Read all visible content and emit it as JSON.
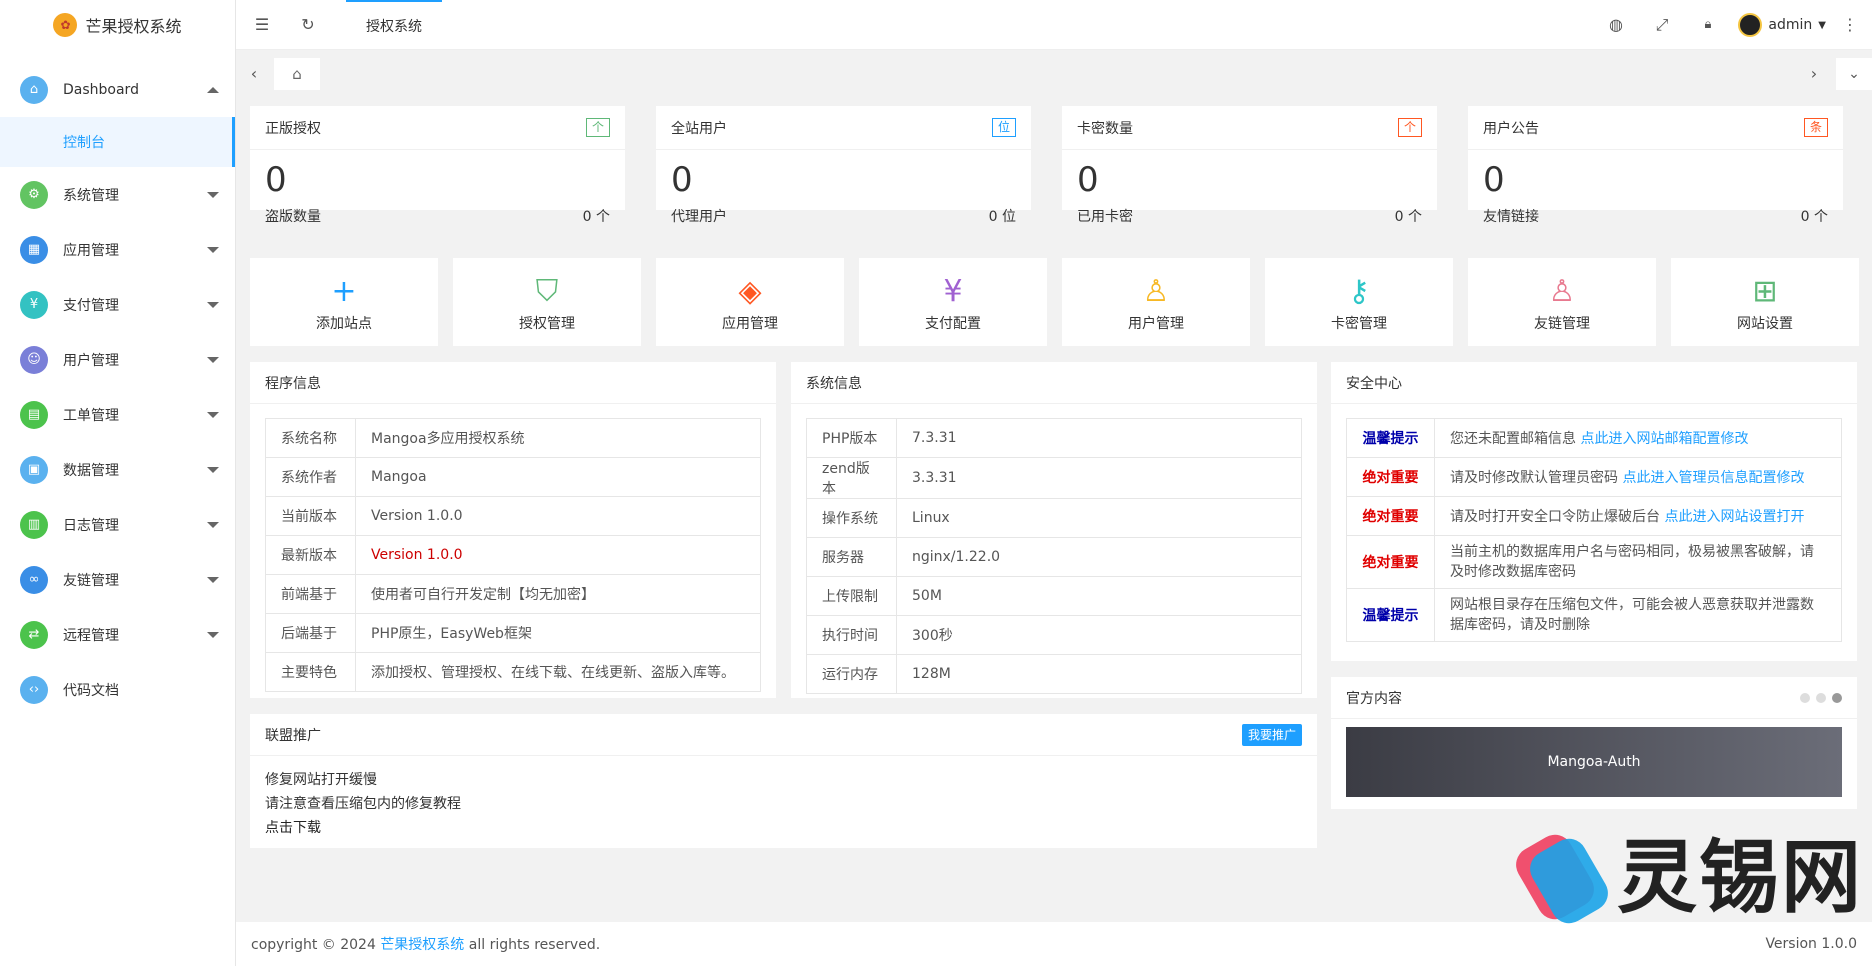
{
  "app": {
    "title": "芒果授权系统",
    "logo_glyph": "✿"
  },
  "sidebar": {
    "items": [
      {
        "label": "Dashboard",
        "icon": "⌂",
        "color": "#5ab1ef",
        "expanded": true
      },
      {
        "label": "系统管理",
        "icon": "⚙",
        "color": "#62c462"
      },
      {
        "label": "应用管理",
        "icon": "▦",
        "color": "#3a8ee6"
      },
      {
        "label": "支付管理",
        "icon": "¥",
        "color": "#33c2c2"
      },
      {
        "label": "用户管理",
        "icon": "☺",
        "color": "#7a7fd8"
      },
      {
        "label": "工单管理",
        "icon": "▤",
        "color": "#4cc34c"
      },
      {
        "label": "数据管理",
        "icon": "▣",
        "color": "#5ab1ef"
      },
      {
        "label": "日志管理",
        "icon": "▥",
        "color": "#4cc34c"
      },
      {
        "label": "友链管理",
        "icon": "∞",
        "color": "#3a8ee6"
      },
      {
        "label": "远程管理",
        "icon": "⇄",
        "color": "#4cc34c"
      },
      {
        "label": "代码文档",
        "icon": "‹›",
        "color": "#5ab1ef"
      }
    ],
    "sub_active": "控制台"
  },
  "header": {
    "tab": "授权系统",
    "user": "admin",
    "icons": {
      "menu": "☰",
      "refresh": "↻",
      "globe": "◍",
      "fullscreen": "⤢",
      "lock": "🔒︎",
      "more": "⋮"
    }
  },
  "tabbar": {
    "prev": "‹",
    "next": "›",
    "home": "⌂",
    "down": "⌄"
  },
  "stats": [
    {
      "title": "正版授权",
      "badge": "个",
      "badge_color": "#5fb878",
      "value": "0",
      "sub_label": "盗版数量",
      "sub_value": "0 个"
    },
    {
      "title": "全站用户",
      "badge": "位",
      "badge_color": "#1E9FFF",
      "value": "0",
      "sub_label": "代理用户",
      "sub_value": "0 位"
    },
    {
      "title": "卡密数量",
      "badge": "个",
      "badge_color": "#FF5722",
      "value": "0",
      "sub_label": "已用卡密",
      "sub_value": "0 个"
    },
    {
      "title": "用户公告",
      "badge": "条",
      "badge_color": "#FF5722",
      "value": "0",
      "sub_label": "友情链接",
      "sub_value": "0 个"
    }
  ],
  "quick": [
    {
      "label": "添加站点",
      "icon": "+",
      "color": "#1E9FFF"
    },
    {
      "label": "授权管理",
      "icon": "⛉",
      "color": "#5fb878"
    },
    {
      "label": "应用管理",
      "icon": "◈",
      "color": "#FF5722"
    },
    {
      "label": "支付配置",
      "icon": "¥",
      "color": "#a061d1"
    },
    {
      "label": "用户管理",
      "icon": "♙",
      "color": "#f7b824"
    },
    {
      "label": "卡密管理",
      "icon": "⚷",
      "color": "#2ec6c8"
    },
    {
      "label": "友链管理",
      "icon": "♙",
      "color": "#e8798f"
    },
    {
      "label": "网站设置",
      "icon": "⊞",
      "color": "#5fb878"
    }
  ],
  "program": {
    "title": "程序信息",
    "rows": [
      {
        "k": "系统名称",
        "v": "Mangoa多应用授权系统"
      },
      {
        "k": "系统作者",
        "v": "Mangoa"
      },
      {
        "k": "当前版本",
        "v": "Version 1.0.0"
      },
      {
        "k": "最新版本",
        "v": "Version 1.0.0",
        "red": true
      },
      {
        "k": "前端基于",
        "v": "使用者可自行开发定制【均无加密】"
      },
      {
        "k": "后端基于",
        "v": "PHP原生，EasyWeb框架"
      },
      {
        "k": "主要特色",
        "v": "添加授权、管理授权、在线下载、在线更新、盗版入库等。"
      }
    ]
  },
  "system": {
    "title": "系统信息",
    "rows": [
      {
        "k": "PHP版本",
        "v": "7.3.31"
      },
      {
        "k": "zend版本",
        "v": "3.3.31"
      },
      {
        "k": "操作系统",
        "v": "Linux"
      },
      {
        "k": "服务器",
        "v": "nginx/1.22.0"
      },
      {
        "k": "上传限制",
        "v": "50M"
      },
      {
        "k": "执行时间",
        "v": "300秒"
      },
      {
        "k": "运行内存",
        "v": "128M"
      }
    ]
  },
  "security": {
    "title": "安全中心",
    "rows": [
      {
        "tag": "温馨提示",
        "tag_color": "#0000aa",
        "text": "您还未配置邮箱信息 ",
        "link": "点此进入网站邮箱配置修改"
      },
      {
        "tag": "绝对重要",
        "tag_color": "#e00000",
        "text": "请及时修改默认管理员密码 ",
        "link": "点此进入管理员信息配置修改"
      },
      {
        "tag": "绝对重要",
        "tag_color": "#e00000",
        "text": "请及时打开安全口令防止爆破后台 ",
        "link": "点此进入网站设置打开"
      },
      {
        "tag": "绝对重要",
        "tag_color": "#e00000",
        "text": "当前主机的数据库用户名与密码相同，极易被黑客破解，请及时修改数据库密码",
        "link": ""
      },
      {
        "tag": "温馨提示",
        "tag_color": "#0000aa",
        "text": "网站根目录存在压缩包文件，可能会被人恶意获取并泄露数据库密码，请及时删除",
        "link": ""
      }
    ]
  },
  "promo": {
    "title": "联盟推广",
    "button": "我要推广",
    "lines": [
      "修复网站打开缓慢",
      "请注意查看压缩包内的修复教程",
      "点击下载"
    ]
  },
  "official": {
    "title": "官方内容",
    "banner": "Mangoa-Auth"
  },
  "footer": {
    "prefix": "copyright © 2024 ",
    "link": "芒果授权系统",
    "suffix": " all rights reserved.",
    "version": "Version 1.0.0"
  },
  "watermark": {
    "text": "灵锡网"
  }
}
